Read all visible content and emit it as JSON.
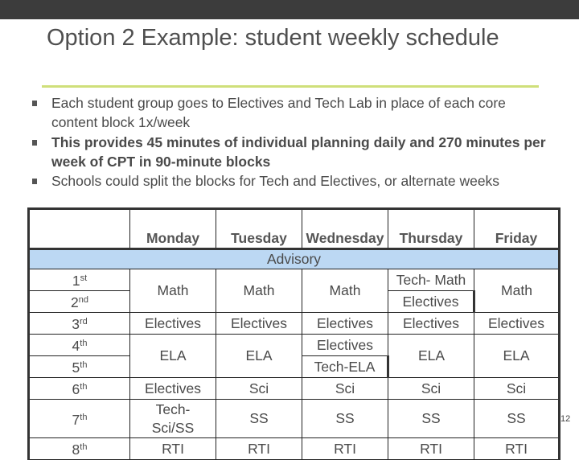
{
  "slide": {
    "title": "Option 2 Example: student weekly schedule",
    "page_number": "12",
    "colors": {
      "top_bar": "#3c3c3c",
      "title_rule": "#cfdf7a",
      "advisory_row": "#bcd8f3",
      "text": "#4a4a4a"
    }
  },
  "bullets": [
    {
      "text": "Each student group goes to Electives and Tech Lab in place of each core content block 1x/week",
      "bold": false
    },
    {
      "text": "This provides 45 minutes of individual planning daily and 270 minutes per week of CPT in 90-minute blocks",
      "bold": true
    },
    {
      "text": "Schools could split the blocks for Tech and Electives, or alternate weeks",
      "bold": false
    }
  ],
  "schedule": {
    "headers": [
      "",
      "Monday",
      "Tuesday",
      "Wednesday",
      "Thursday",
      "Friday"
    ],
    "advisory_label": "Advisory",
    "periods": [
      {
        "num": "1",
        "suffix": "st"
      },
      {
        "num": "2",
        "suffix": "nd"
      },
      {
        "num": "3",
        "suffix": "rd"
      },
      {
        "num": "4",
        "suffix": "th"
      },
      {
        "num": "5",
        "suffix": "th"
      },
      {
        "num": "6",
        "suffix": "th"
      },
      {
        "num": "7",
        "suffix": "th"
      },
      {
        "num": "8",
        "suffix": "th"
      }
    ],
    "cells": {
      "p12": {
        "monday": "Math",
        "tuesday": "Math",
        "wednesday": "Math",
        "thursday_1": "Tech- Math",
        "thursday_2": "Electives",
        "friday": "Math"
      },
      "p3": {
        "monday": "Electives",
        "tuesday": "Electives",
        "wednesday": "Electives",
        "thursday": "Electives",
        "friday": "Electives"
      },
      "p45": {
        "monday": "ELA",
        "tuesday": "ELA",
        "wednesday_4": "Electives",
        "wednesday_5": "Tech-ELA",
        "thursday": "ELA",
        "friday": "ELA"
      },
      "p6": {
        "monday": "Electives",
        "tuesday": "Sci",
        "wednesday": "Sci",
        "thursday": "Sci",
        "friday": "Sci"
      },
      "p7": {
        "monday": "Tech- Sci/SS",
        "tuesday": "SS",
        "wednesday": "SS",
        "thursday": "SS",
        "friday": "SS"
      },
      "p8": {
        "monday": "RTI",
        "tuesday": "RTI",
        "wednesday": "RTI",
        "thursday": "RTI",
        "friday": "RTI"
      }
    }
  }
}
